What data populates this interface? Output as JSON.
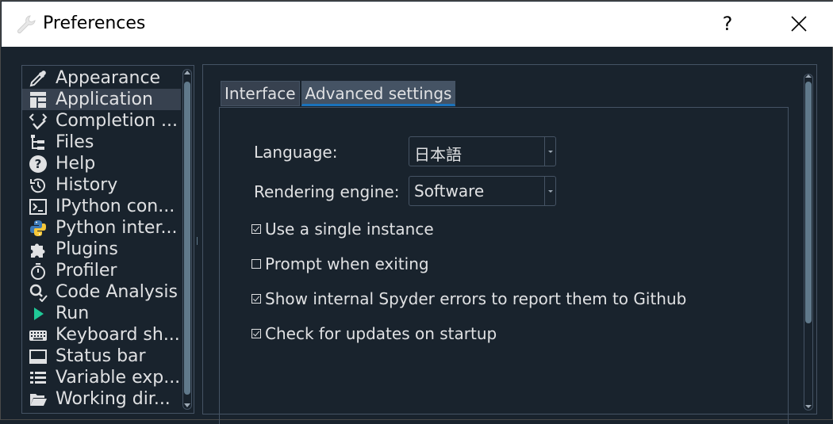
{
  "window": {
    "title": "Preferences",
    "help_label": "?",
    "close_icon": "close-icon"
  },
  "sidebar": {
    "items": [
      {
        "label": "Appearance",
        "icon": "eyedropper-icon"
      },
      {
        "label": "Application",
        "icon": "layout-icon"
      },
      {
        "label": "Completion ...",
        "icon": "code-check-icon"
      },
      {
        "label": "Files",
        "icon": "file-tree-icon"
      },
      {
        "label": "Help",
        "icon": "help-circle-icon"
      },
      {
        "label": "History",
        "icon": "history-icon"
      },
      {
        "label": "IPython con...",
        "icon": "console-icon"
      },
      {
        "label": "Python inter...",
        "icon": "python-icon"
      },
      {
        "label": "Plugins",
        "icon": "puzzle-icon"
      },
      {
        "label": "Profiler",
        "icon": "stopwatch-icon"
      },
      {
        "label": "Code Analysis",
        "icon": "code-analysis-icon"
      },
      {
        "label": "Run",
        "icon": "play-icon"
      },
      {
        "label": "Keyboard sh...",
        "icon": "keyboard-icon"
      },
      {
        "label": "Status bar",
        "icon": "statusbar-icon"
      },
      {
        "label": "Variable exp...",
        "icon": "list-icon"
      },
      {
        "label": "Working dir...",
        "icon": "folder-icon"
      }
    ],
    "selected_index": 1
  },
  "tabs": [
    {
      "label": "Interface",
      "active": false
    },
    {
      "label": "Advanced settings",
      "active": true
    }
  ],
  "form": {
    "language_label": "Language:",
    "language_value": "日本語",
    "rendering_label": "Rendering engine:",
    "rendering_value": "Software",
    "options": [
      {
        "label": "Use a single instance",
        "checked": true
      },
      {
        "label": "Prompt when exiting",
        "checked": false
      },
      {
        "label": "Show internal Spyder errors to report them to Github",
        "checked": true
      },
      {
        "label": "Check for updates on startup",
        "checked": true
      }
    ]
  },
  "colors": {
    "background": "#19232d",
    "border": "#455364",
    "selected": "#37414f",
    "accent": "#1a72bb",
    "text": "#e0e1e3"
  }
}
